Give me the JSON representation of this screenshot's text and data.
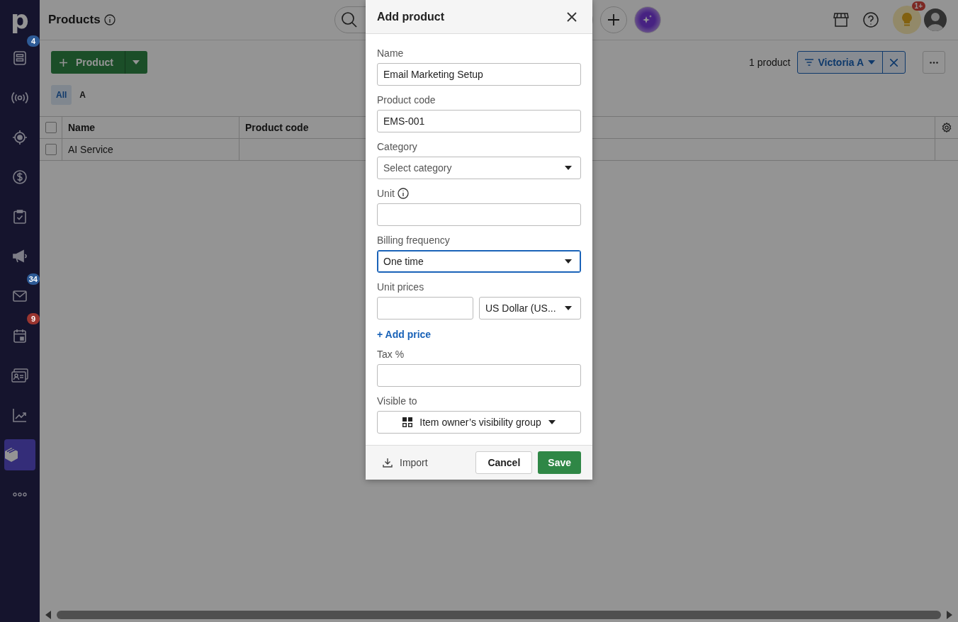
{
  "sidebar": {
    "logo": "p",
    "items": [
      {
        "kind": "leads",
        "badge": {
          "label": "4",
          "color": "#2e5b96"
        },
        "selected": false
      },
      {
        "kind": "signal",
        "selected": false
      },
      {
        "kind": "target",
        "selected": false
      },
      {
        "kind": "dollar",
        "selected": false
      },
      {
        "kind": "clipboard",
        "selected": false
      },
      {
        "kind": "megaphone",
        "selected": false
      },
      {
        "kind": "mail",
        "badge": {
          "label": "34",
          "color": "#2e5b96"
        },
        "selected": false
      },
      {
        "kind": "calendar",
        "badge": {
          "label": "9",
          "color": "#9a3530"
        },
        "selected": false
      },
      {
        "kind": "contacts",
        "selected": false
      },
      {
        "kind": "chart",
        "selected": false
      },
      {
        "kind": "box",
        "selected": true
      },
      {
        "kind": "more",
        "selected": false
      }
    ]
  },
  "header": {
    "title": "Products",
    "notification_badge": "1+"
  },
  "toolbar": {
    "add_button": "Product",
    "count": "1 product",
    "filter": "Victoria A"
  },
  "filter_tabs": [
    {
      "label": "All",
      "selected": true
    },
    {
      "label": "A",
      "selected": false
    }
  ],
  "table": {
    "select_all_checked": false,
    "columns": [
      "Name",
      "Product code"
    ],
    "rows": [
      {
        "checked": false,
        "cells": [
          "AI Service",
          ""
        ]
      }
    ]
  },
  "dialog": {
    "title": "Add product",
    "fields": [
      {
        "kind": "text",
        "label": "Name",
        "value": "Email Marketing Setup"
      },
      {
        "kind": "text",
        "label": "Product code",
        "value": "EMS-001"
      },
      {
        "kind": "select",
        "label": "Category",
        "placeholder": "Select category",
        "focused": false
      },
      {
        "kind": "text",
        "label": "Unit",
        "info": true
      },
      {
        "kind": "select",
        "label": "Billing frequency",
        "value": "One time",
        "focused": true
      },
      {
        "kind": "price",
        "label": "Unit prices",
        "currency": "US Dollar (US...",
        "link": "+ Add price"
      },
      {
        "kind": "text",
        "label": "Tax %"
      },
      {
        "kind": "visibility",
        "label": "Visible to",
        "value": "Item owner’s visibility group"
      }
    ],
    "import": "Import",
    "cancel": "Cancel",
    "save": "Save"
  }
}
